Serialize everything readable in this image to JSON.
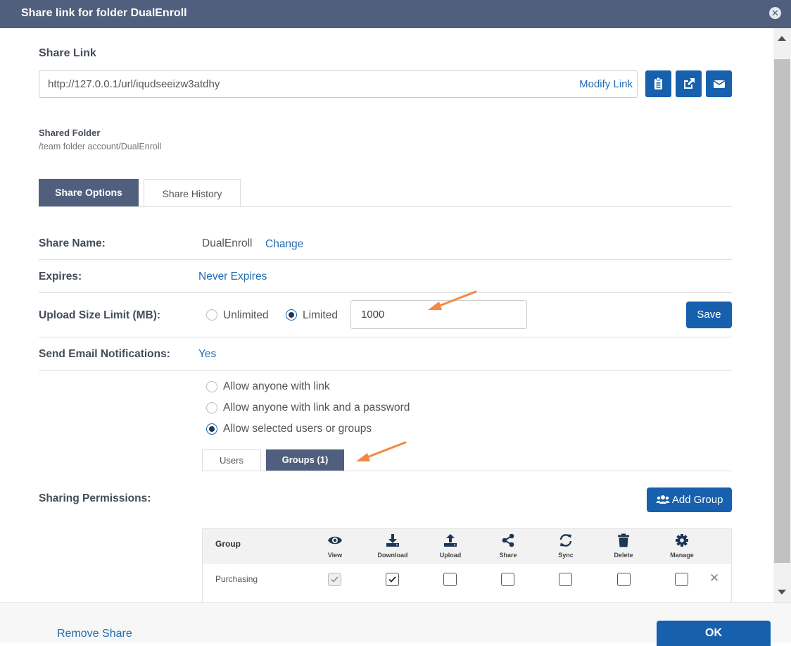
{
  "dialog": {
    "title": "Share link for folder DualEnroll"
  },
  "share_link": {
    "heading": "Share Link",
    "url": "http://127.0.0.1/url/iqudseeizw3atdhy",
    "modify_label": "Modify Link"
  },
  "shared_folder": {
    "label": "Shared Folder",
    "path": "/team folder account/DualEnroll"
  },
  "tabs": [
    {
      "label": "Share Options",
      "active": true
    },
    {
      "label": "Share History",
      "active": false
    }
  ],
  "options": {
    "share_name": {
      "label": "Share Name:",
      "value": "DualEnroll",
      "change": "Change"
    },
    "expires": {
      "label": "Expires:",
      "value": "Never Expires"
    },
    "upload_limit": {
      "label": "Upload Size Limit (MB):",
      "unlimited": "Unlimited",
      "limited": "Limited",
      "selected": "Limited",
      "value": "1000",
      "save": "Save"
    },
    "email_notifications": {
      "label": "Send Email Notifications:",
      "value": "Yes"
    }
  },
  "access": {
    "options": [
      {
        "label": "Allow anyone with link",
        "checked": false
      },
      {
        "label": "Allow anyone with link and a password",
        "checked": false
      },
      {
        "label": "Allow selected users or groups",
        "checked": true
      }
    ]
  },
  "subtabs": [
    {
      "label": "Users",
      "active": false
    },
    {
      "label": "Groups (1)",
      "active": true
    }
  ],
  "permissions": {
    "label": "Sharing Permissions:",
    "add_group": "Add Group",
    "columns": [
      "Group",
      "View",
      "Download",
      "Upload",
      "Share",
      "Sync",
      "Delete",
      "Manage"
    ],
    "rows": [
      {
        "name": "Purchasing",
        "view": true,
        "download": true,
        "upload": false,
        "share": false,
        "sync": false,
        "delete": false,
        "manage": false
      }
    ]
  },
  "footer": {
    "remove_share": "Remove Share",
    "ok": "OK"
  },
  "colors": {
    "accent": "#1660ad",
    "header": "#505f7e",
    "annotation_arrow": "#f58742"
  }
}
